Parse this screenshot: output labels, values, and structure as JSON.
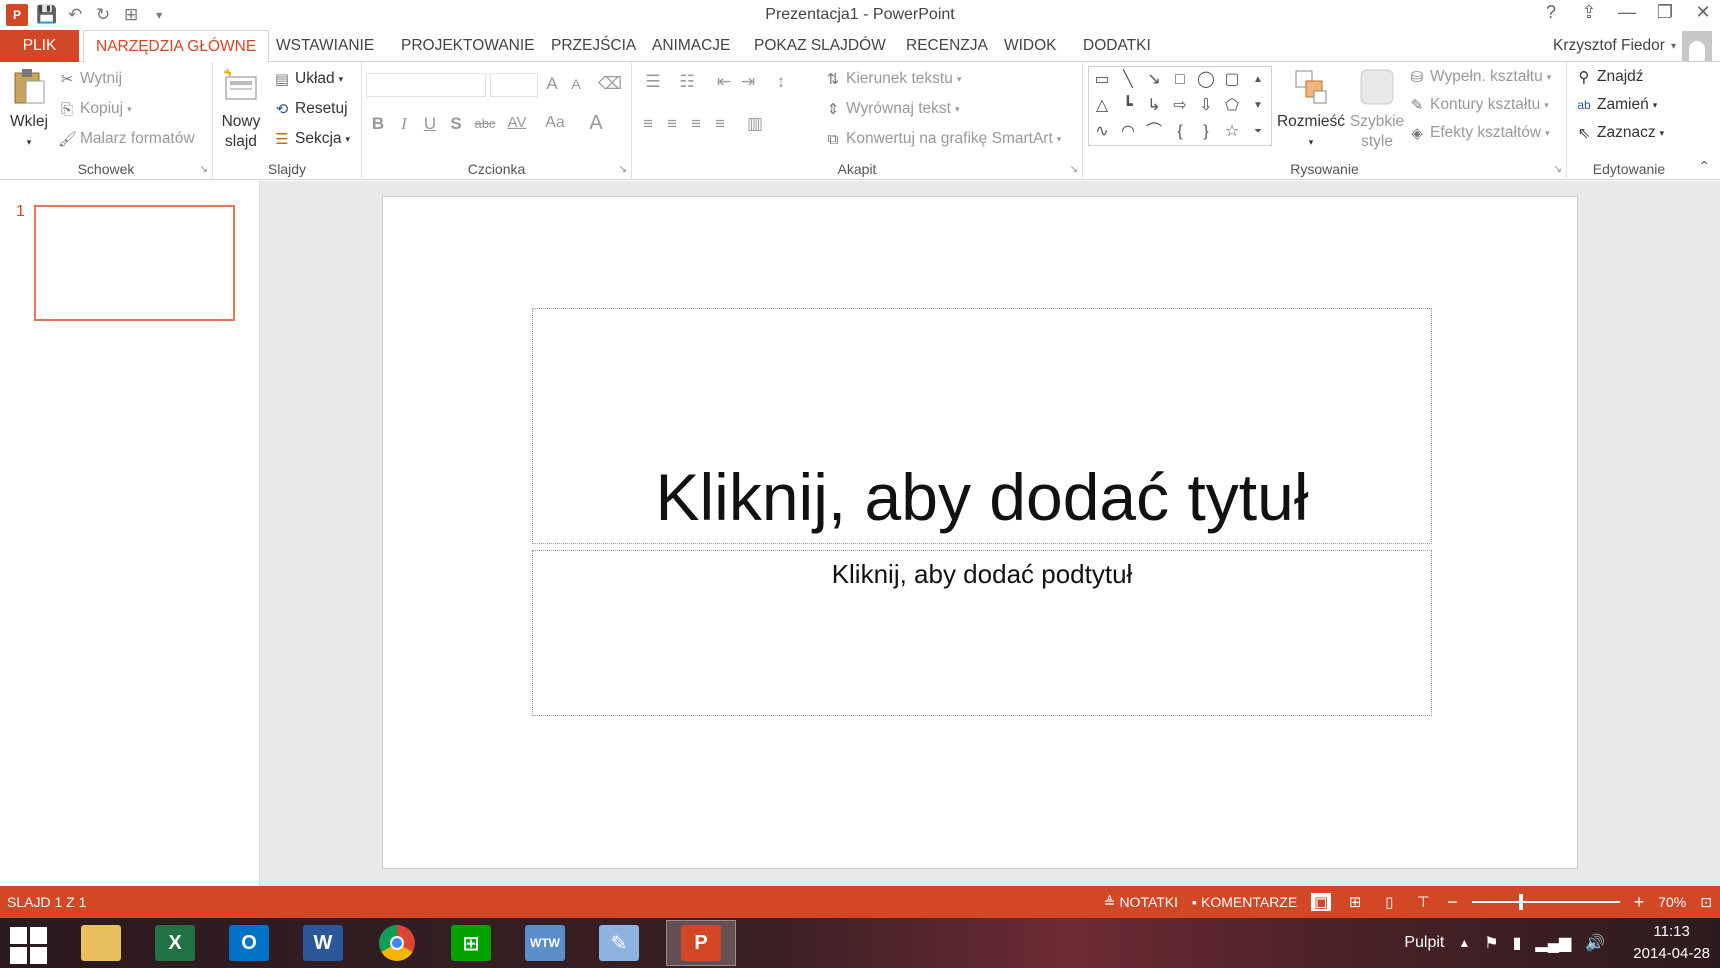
{
  "window": {
    "title": "Prezentacja1 - PowerPoint",
    "controls": {
      "help": "?",
      "ribbon_display": "⇪",
      "minimize": "—",
      "restore": "❐",
      "close": "✕"
    }
  },
  "qat": {
    "app_icon": "P",
    "save": "💾",
    "undo": "↶",
    "redo": "↻",
    "present": "⊞",
    "customize": "▾"
  },
  "tabs": {
    "file": "PLIK",
    "items": [
      "NARZĘDZIA GŁÓWNE",
      "WSTAWIANIE",
      "PROJEKTOWANIE",
      "PRZEJŚCIA",
      "ANIMACJE",
      "POKAZ SLAJDÓW",
      "RECENZJA",
      "WIDOK",
      "DODATKI"
    ],
    "user": "Krzysztof Fiedor"
  },
  "ribbon": {
    "clipboard": {
      "label": "Schowek",
      "paste": "Wklej",
      "cut": "Wytnij",
      "copy": "Kopiuj",
      "format_painter": "Malarz formatów"
    },
    "slides": {
      "label": "Slajdy",
      "new_slide_1": "Nowy",
      "new_slide_2": "slajd",
      "layout": "Układ",
      "reset": "Resetuj",
      "section": "Sekcja"
    },
    "font": {
      "label": "Czcionka",
      "bold": "B",
      "italic": "I",
      "underline": "U",
      "shadow": "S",
      "strike": "abc",
      "spacing": "AV",
      "case": "Aa",
      "color": "A",
      "grow": "A",
      "shrink": "A"
    },
    "paragraph": {
      "label": "Akapit",
      "text_direction": "Kierunek tekstu",
      "align_text": "Wyrównaj tekst",
      "smartart": "Konwertuj na grafikę SmartArt"
    },
    "drawing": {
      "label": "Rysowanie",
      "arrange": "Rozmieść",
      "quick_styles_1": "Szybkie",
      "quick_styles_2": "style",
      "fill": "Wypełn. kształtu",
      "outline": "Kontury kształtu",
      "effects": "Efekty kształtów"
    },
    "editing": {
      "label": "Edytowanie",
      "find": "Znajdź",
      "replace": "Zamień",
      "select": "Zaznacz"
    }
  },
  "slides_pane": {
    "number": "1"
  },
  "slide": {
    "title_placeholder": "Kliknij, aby dodać tytuł",
    "subtitle_placeholder": "Kliknij, aby dodać podtytuł"
  },
  "statusbar": {
    "slide_info": "SLAJD 1 Z 1",
    "notes": "NOTATKI",
    "comments": "KOMENTARZE",
    "zoom": "70%",
    "zoom_value": 0.7
  },
  "taskbar": {
    "apps": [
      "explorer-icon",
      "excel-icon",
      "outlook-icon",
      "word-icon",
      "chrome-icon",
      "store-icon",
      "wtw-icon",
      "paint-icon",
      "powerpoint-icon"
    ],
    "desktop_label": "Pulpit",
    "time": "11:13",
    "date": "2014-04-28"
  }
}
